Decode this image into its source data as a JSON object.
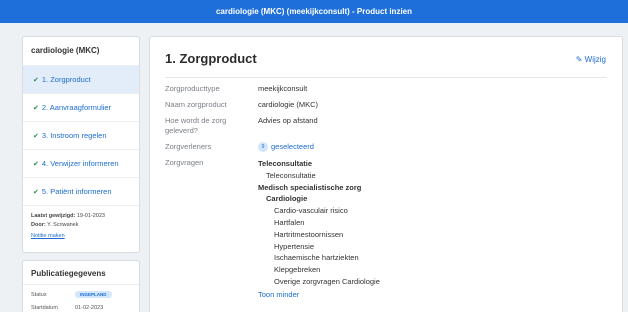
{
  "header": {
    "title": "cardiologie (MKC) (meekijkconsult) - Product inzien"
  },
  "sidebar": {
    "title": "cardiologie (MKC)",
    "steps": [
      {
        "label": "1. Zorgproduct"
      },
      {
        "label": "2. Aanvraagformulier"
      },
      {
        "label": "3. Instroom regelen"
      },
      {
        "label": "4. Verwijzer informeren"
      },
      {
        "label": "5. Patiënt informeren"
      }
    ],
    "last_modified_label": "Laatst gewijzigd:",
    "last_modified_value": "19-01-2023",
    "by_label": "Door:",
    "by_value": "Y. Scriwanek",
    "notes_link": "Notitie maken"
  },
  "publication": {
    "title": "Publicatiegegevens",
    "status_label": "Status",
    "status_value": "INGEPLAND",
    "start_label": "Startdatum",
    "start_value": "01-02-2023"
  },
  "main": {
    "title": "1. Zorgproduct",
    "edit_label": "Wijzig",
    "fields": {
      "type_label": "Zorgproducttype",
      "type_value": "meekijkconsult",
      "name_label": "Naam zorgproduct",
      "name_value": "cardiologie (MKC)",
      "delivery_label": "Hoe wordt de zorg geleverd?",
      "delivery_value": "Advies op afstand",
      "providers_label": "Zorgverleners",
      "providers_count": "9",
      "providers_value": "geselecteerd",
      "questions_label": "Zorgvragen"
    },
    "questions": {
      "g1": "Teleconsultatie",
      "g1_i1": "Teleconsultatie",
      "g2": "Medisch specialistische zorg",
      "g2_sub": "Cardiologie",
      "items": [
        "Cardio-vasculair risico",
        "Hartfalen",
        "Hartritmestoornissen",
        "Hypertensie",
        "Ischaemische hartziekten",
        "Klepgebreken",
        "Overige zorgvragen Cardiologie"
      ],
      "less_label": "Toon minder"
    }
  }
}
